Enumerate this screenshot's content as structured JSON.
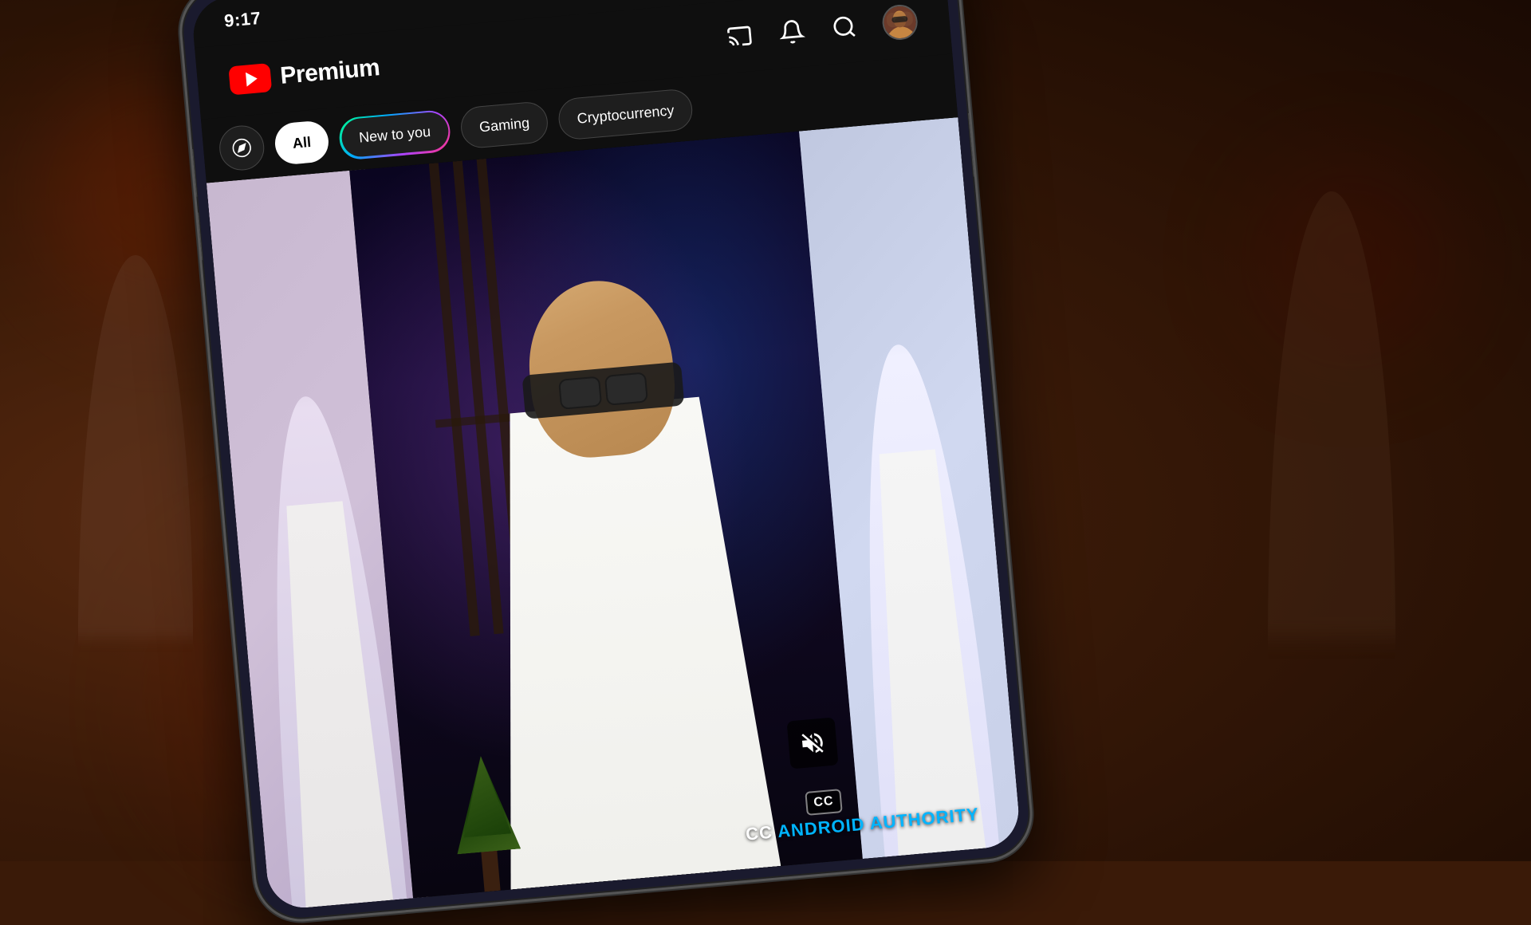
{
  "background": {
    "color": "#3a1a08"
  },
  "device": {
    "type": "smartphone",
    "orientation": "portrait"
  },
  "status_bar": {
    "time": "9:17",
    "icons": {
      "wifi": "wifi-icon",
      "signal": "signal-icon",
      "battery": "battery-icon"
    }
  },
  "app": {
    "name": "YouTube Premium",
    "logo_icon": "youtube-play-icon",
    "logo_text": "Premium"
  },
  "header_actions": {
    "cast_label": "cast",
    "notifications_label": "notifications",
    "search_label": "search",
    "profile_label": "profile"
  },
  "chips": {
    "explore_label": "explore",
    "all_label": "All",
    "new_to_you_label": "New to you",
    "gaming_label": "Gaming",
    "cryptocurrency_label": "Cryptocurrency"
  },
  "video": {
    "mute_icon": "mute-icon",
    "cc_label": "CC"
  },
  "watermark": {
    "prefix": "CC ",
    "brand": "ANDROID AUTHORITY"
  }
}
